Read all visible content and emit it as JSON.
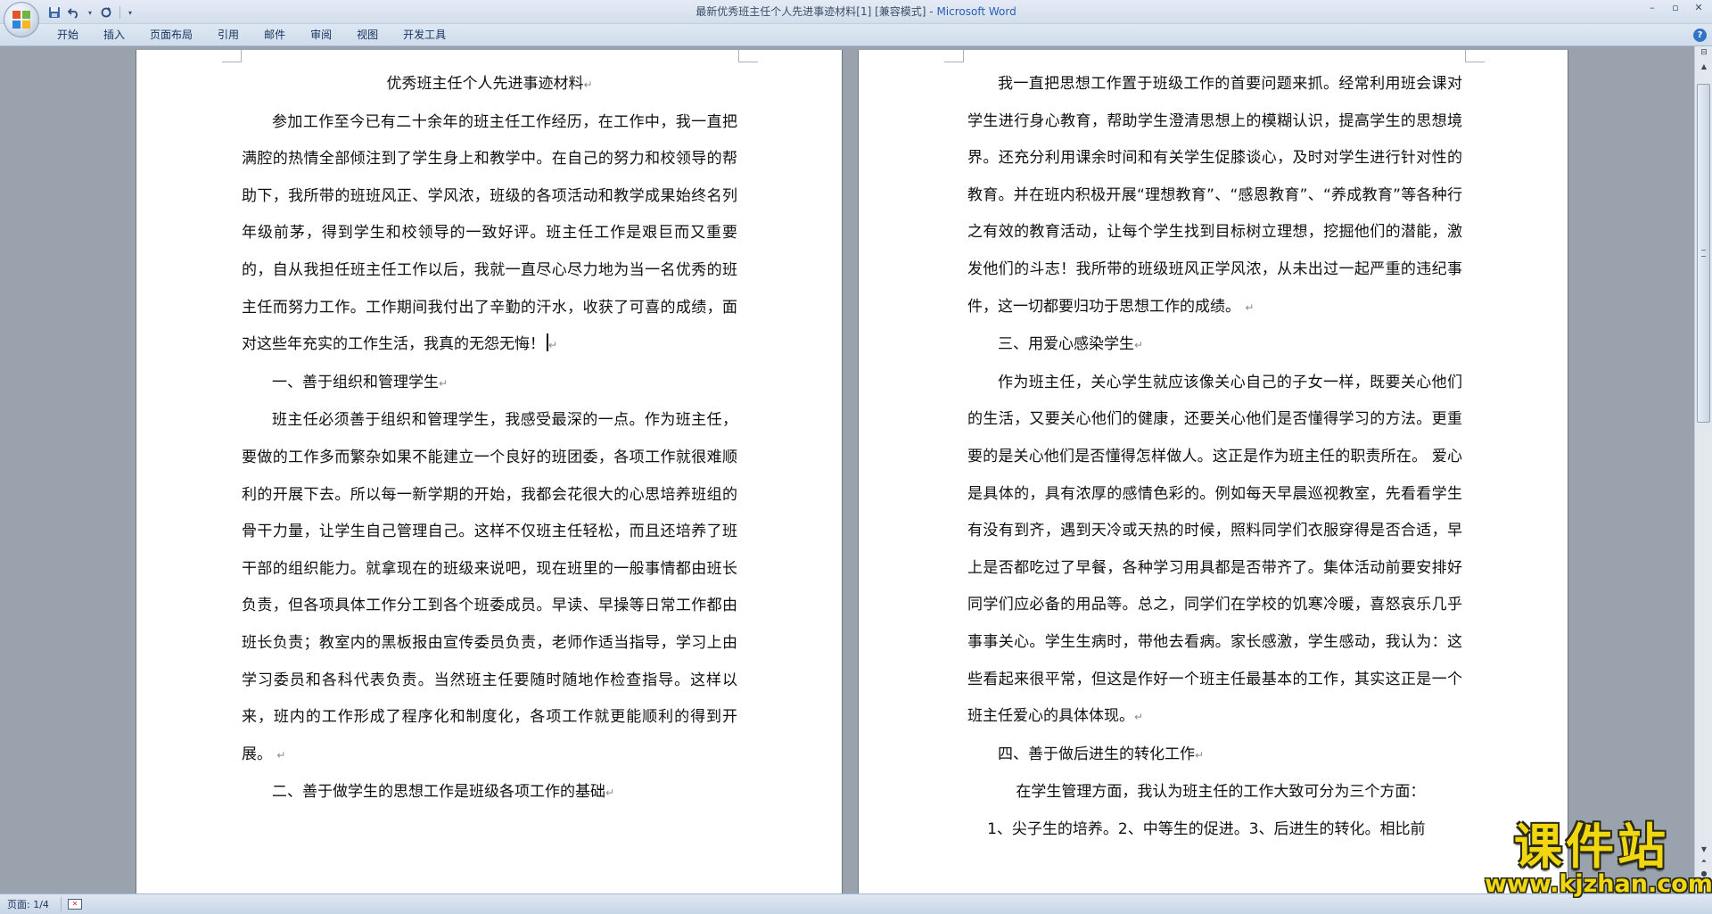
{
  "window": {
    "title": "最新优秀班主任个人先进事迹材料[1] [兼容模式]",
    "title_sep": " - ",
    "app_name": "Microsoft Word",
    "minimize": "–",
    "restore": "▫",
    "close": "✕"
  },
  "quick_access": {
    "save_icon": "save-icon",
    "undo_icon": "undo-icon",
    "redo_icon": "redo-icon"
  },
  "ribbon": {
    "tabs": [
      {
        "label": "开始"
      },
      {
        "label": "插入"
      },
      {
        "label": "页面布局"
      },
      {
        "label": "引用"
      },
      {
        "label": "邮件"
      },
      {
        "label": "审阅"
      },
      {
        "label": "视图"
      },
      {
        "label": "开发工具"
      }
    ],
    "help": "?"
  },
  "document": {
    "left_page": {
      "title": "优秀班主任个人先进事迹材料",
      "para1": "参加工作至今已有二十余年的班主任工作经历，在工作中，我一直把满腔的热情全部倾注到了学生身上和教学中。在自己的努力和校领导的帮助下，我所带的班班风正、学风浓，班级的各项活动和教学成果始终名列年级前茅，得到学生和校领导的一致好评。班主任工作是艰巨而又重要的，自从我担任班主任工作以后，我就一直尽心尽力地为当一名优秀的班主任而努力工作。工作期间我付出了辛勤的汗水，收获了可喜的成绩，面对这些年充实的工作生活，我真的无怨无悔！",
      "heading1": "一、善于组织和管理学生",
      "para2": "班主任必须善于组织和管理学生，我感受最深的一点。作为班主任，要做的工作多而繁杂如果不能建立一个良好的班团委，各项工作就很难顺利的开展下去。所以每一新学期的开始，我都会花很大的心思培养班组的骨干力量，让学生自己管理自己。这样不仅班主任轻松，而且还培养了班干部的组织能力。就拿现在的班级来说吧，现在班里的一般事情都由班长负责，但各项具体工作分工到各个班委成员。早读、早操等日常工作都由班长负责；教室内的黑板报由宣传委员负责，老师作适当指导，学习上由学习委员和各科代表负责。当然班主任要随时随地作检查指导。这样以来，班内的工作形成了程序化和制度化，各项工作就更能顺利的得到开展。",
      "heading2": "二、善于做学生的思想工作是班级各项工作的基础"
    },
    "right_page": {
      "para1": "我一直把思想工作置于班级工作的首要问题来抓。经常利用班会课对学生进行身心教育，帮助学生澄清思想上的模糊认识，提高学生的思想境界。还充分利用课余时间和有关学生促膝谈心，及时对学生进行针对性的教育。并在班内积极开展“理想教育”、“感恩教育”、“养成教育”等各种行之有效的教育活动，让每个学生找到目标树立理想，挖掘他们的潜能，激发他们的斗志！我所带的班级班风正学风浓，从未出过一起严重的违纪事件，这一切都要归功于思想工作的成绩。",
      "heading3": "三、用爱心感染学生",
      "para2": "作为班主任，关心学生就应该像关心自己的子女一样，既要关心他们的生活，又要关心他们的健康，还要关心他们是否懂得学习的方法。更重要的是关心他们是否懂得怎样做人。这正是作为班主任的职责所在。 爱心是具体的，具有浓厚的感情色彩的。例如每天早晨巡视教室，先看看学生有没有到齐，遇到天冷或天热的时候，照料同学们衣服穿得是否合适，早上是否都吃过了早餐，各种学习用具都是否带齐了。集体活动前要安排好同学们应必备的用品等。总之，同学们在学校的饥寒冷暖，喜怒哀乐几乎事事关心。学生生病时，带他去看病。家长感激，学生感动，我认为：这些看起来很平常，但这是作好一个班主任最基本的工作，其实这正是一个班主任爱心的具体体现。",
      "heading4": "四、善于做后进生的转化工作",
      "para3": "在学生管理方面，我认为班主任的工作大致可分为三个方面：",
      "para4": "1、尖子生的培养。2、中等生的促进。3、后进生的转化。相比前"
    },
    "paragraph_mark": "↵"
  },
  "status": {
    "page": "页面: 1/4"
  },
  "watermark": {
    "main": "课件站",
    "url": "www.kjzhan.com"
  }
}
